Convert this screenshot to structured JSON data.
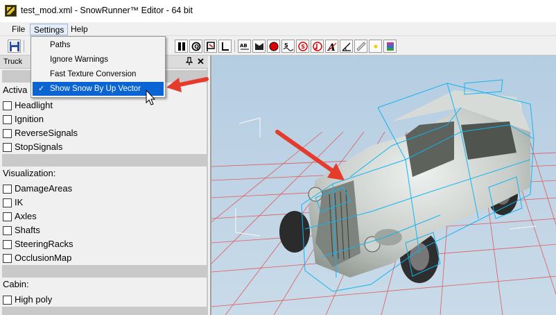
{
  "window": {
    "title": "test_mod.xml - SnowRunner™ Editor - 64 bit"
  },
  "menubar": {
    "items": [
      {
        "label": "File"
      },
      {
        "label": "Settings"
      },
      {
        "label": "Help"
      }
    ]
  },
  "settings_menu": {
    "items": [
      {
        "label": "Paths",
        "checked": false
      },
      {
        "label": "Ignore Warnings",
        "checked": false
      },
      {
        "label": "Fast Texture Conversion",
        "checked": false
      },
      {
        "label": "Show Snow By Up Vector",
        "checked": true,
        "check_mark": "✓"
      }
    ]
  },
  "toolbar": {
    "icons": [
      "save-icon",
      "pause-icon",
      "q-icon",
      "flag-icon",
      "l-icon",
      "ab-icon",
      "truck-icon",
      "record-icon",
      "s-icon",
      "circle-s-icon",
      "music-icon",
      "a-icon",
      "angle-icon",
      "ruler-icon",
      "star-icon",
      "rar-icon"
    ]
  },
  "panel": {
    "title": "Truck",
    "pin_glyph": "📌",
    "close_glyph": "✕",
    "sections": [
      {
        "label": "Activa",
        "items": [
          "Headlight",
          "Ignition",
          "ReverseSignals",
          "StopSignals"
        ]
      },
      {
        "label": "Visualization:",
        "items": [
          "DamageAreas",
          "IK",
          "Axles",
          "Shafts",
          "SteeringRacks",
          "OcclusionMap"
        ]
      },
      {
        "label": "Cabin:",
        "items": [
          "High poly"
        ]
      }
    ]
  },
  "colors": {
    "accent": "#0a64d3",
    "arrow": "#e53b2c",
    "wire": "#00b4ff",
    "grid": "#e05050",
    "sky": "#bcd3e6"
  }
}
